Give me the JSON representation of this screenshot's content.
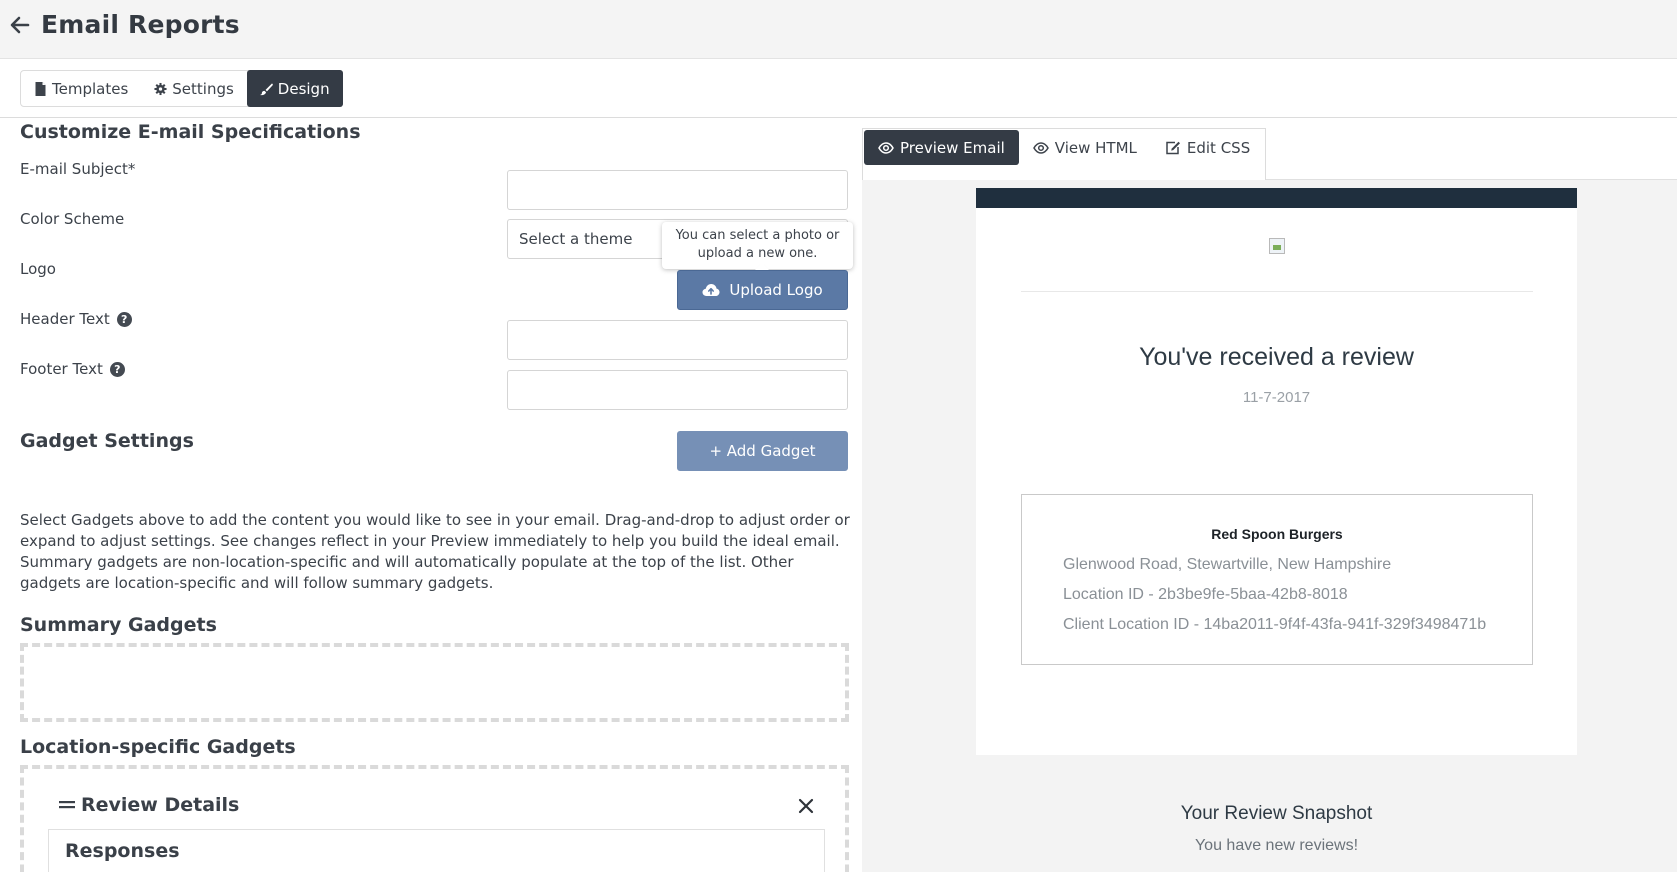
{
  "header": {
    "title": "Email Reports"
  },
  "tabs": [
    {
      "label": "Templates",
      "icon": "file-icon"
    },
    {
      "label": "Settings",
      "icon": "gear-icon"
    },
    {
      "label": "Design",
      "icon": "brush-icon",
      "active": true
    }
  ],
  "form": {
    "section_title": "Customize E-mail Specifications",
    "subject_label": "E-mail Subject*",
    "subject_value": "",
    "color_scheme_label": "Color Scheme",
    "color_scheme_placeholder": "Select a theme",
    "logo_label": "Logo",
    "upload_logo_label": "Upload Logo",
    "logo_tooltip": "You can select a photo or upload a new one.",
    "header_text_label": "Header Text",
    "header_text_value": "",
    "footer_text_label": "Footer Text",
    "footer_text_value": ""
  },
  "gadgets": {
    "section_title": "Gadget Settings",
    "add_button_label": "+ Add Gadget",
    "description": "Select Gadgets above to add the content you would like to see in your email. Drag-and-drop to adjust order or expand to adjust settings. See changes reflect in your Preview immediately to help you build the ideal email. Summary gadgets are non-location-specific and will automatically populate at the top of the list. Other gadgets are location-specific and will follow summary gadgets.",
    "summary_title": "Summary Gadgets",
    "location_title": "Location-specific Gadgets",
    "location_items": [
      {
        "title": "Review Details",
        "sub_title": "Responses"
      }
    ]
  },
  "preview": {
    "tabs": [
      {
        "label": "Preview Email",
        "icon": "eye-icon",
        "active": true
      },
      {
        "label": "View HTML",
        "icon": "eye-icon"
      },
      {
        "label": "Edit CSS",
        "icon": "edit-icon"
      }
    ],
    "email": {
      "title": "You've received a review",
      "date": "11-7-2017",
      "location_name": "Red Spoon Burgers",
      "address": "Glenwood Road, Stewartville, New Hampshire",
      "location_id": "Location ID - 2b3be9fe-5baa-42b8-8018",
      "client_location_id": "Client Location ID - 14ba2011-9f4f-43fa-941f-329f3498471b",
      "snapshot_title": "Your Review Snapshot",
      "snapshot_sub": "You have new reviews!"
    }
  },
  "colors": {
    "dark_tab": "#343b45",
    "primary_button": "#5b79a5",
    "email_header_bar": "#1f2f3e"
  }
}
